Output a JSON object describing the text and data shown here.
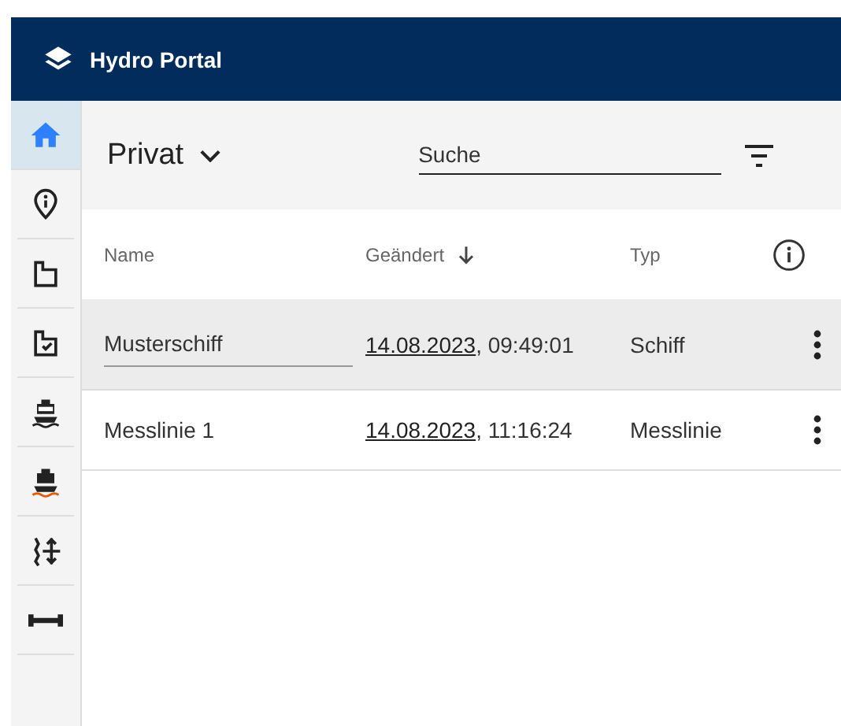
{
  "header": {
    "title": "Hydro Portal"
  },
  "sidebar": {
    "items": [
      {
        "selected": true
      },
      {
        "selected": false
      },
      {
        "selected": false
      },
      {
        "selected": false
      },
      {
        "selected": false
      },
      {
        "selected": false
      },
      {
        "selected": false
      },
      {
        "selected": false
      }
    ]
  },
  "toolbar": {
    "scope": "Privat",
    "search": {
      "placeholder": "Suche"
    }
  },
  "table": {
    "columns": [
      {
        "label": "Name",
        "sorted": false
      },
      {
        "label": "Geändert",
        "sorted": true
      },
      {
        "label": "Typ",
        "sorted": false
      }
    ],
    "rows": [
      {
        "name": "Musterschiff",
        "date": "14.08.2023",
        "time": ", 09:49:01",
        "type": "Schiff",
        "selected": true
      },
      {
        "name": "Messlinie 1",
        "date": "14.08.2023",
        "time": ", 11:16:24",
        "type": "Messlinie",
        "selected": false
      }
    ]
  }
}
